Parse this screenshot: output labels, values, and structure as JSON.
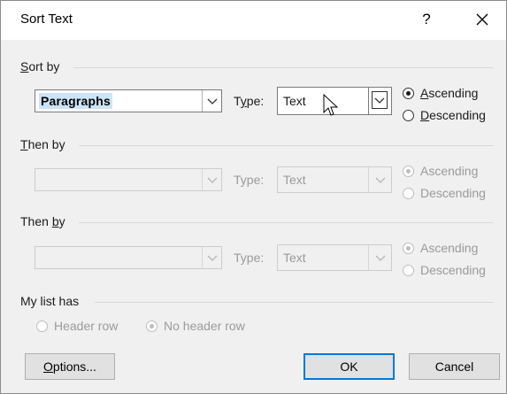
{
  "window": {
    "title": "Sort Text",
    "help_label": "?",
    "close_icon": "close-icon"
  },
  "sort_by": {
    "label_prefix": "",
    "label_accel": "S",
    "label_suffix": "ort by",
    "field_value": "Paragraphs",
    "type_label_prefix": "T",
    "type_label_accel": "y",
    "type_label_suffix": "pe:",
    "type_value": "Text",
    "ascending_accel": "A",
    "ascending_rest": "scending",
    "descending_accel": "D",
    "descending_rest": "escending",
    "selected": "Ascending"
  },
  "then_by_1": {
    "label_accel": "T",
    "label_rest": "hen by",
    "field_value": "",
    "type_label": "Type:",
    "type_value": "Text",
    "ascending": "Ascending",
    "descending": "Descending",
    "selected": "Ascending",
    "disabled": true
  },
  "then_by_2": {
    "label_prefix": "Then ",
    "label_accel": "b",
    "label_rest": "y",
    "field_value": "",
    "type_label": "Type:",
    "type_value": "Text",
    "ascending": "Ascending",
    "descending": "Descending",
    "selected": "Ascending",
    "disabled": true
  },
  "my_list_has": {
    "label": "My list has",
    "header_row": "Header row",
    "no_header_row": "No header row",
    "selected": "No header row",
    "disabled": true
  },
  "buttons": {
    "options_accel": "O",
    "options_rest": "ptions...",
    "ok": "OK",
    "cancel": "Cancel"
  },
  "colors": {
    "dialog_bg": "#f0f0f0",
    "titlebar_bg": "#ffffff",
    "selection_bg": "#cce4f7",
    "default_button_border": "#0078d7",
    "disabled_text": "#9a9a9a"
  }
}
